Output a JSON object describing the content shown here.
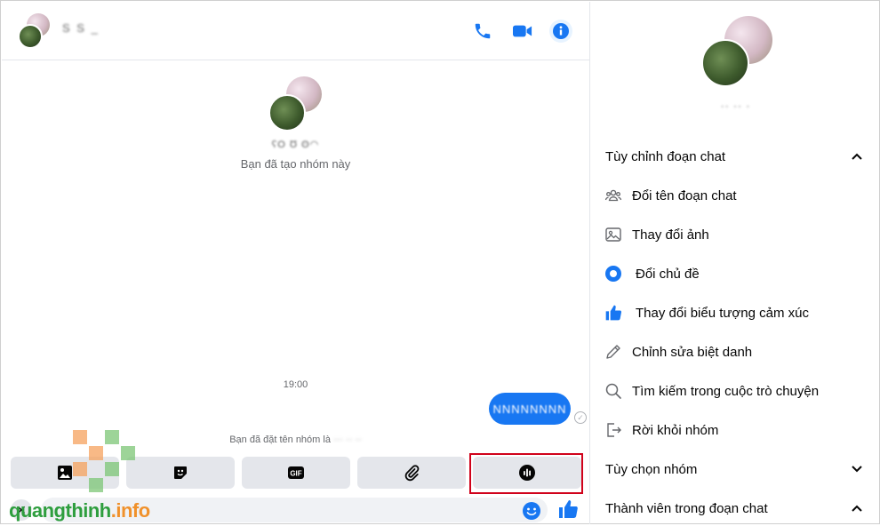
{
  "header": {
    "name": "S  S   _",
    "call_icon": "phone-icon",
    "video_icon": "video-camera-icon",
    "info_icon": "info-icon"
  },
  "conversation": {
    "group_name": "ʕO Ʊ ʘ◠",
    "created_text": "Bạn đã tạo nhóm này",
    "time": "19:00",
    "message": "NNNNNNNN",
    "renamed_prefix": "Bạn đã đặt tên nhóm là",
    "renamed_blur": "··· ·· ··"
  },
  "toolbar": [
    {
      "name": "photo-tool-button",
      "icon": "image-icon"
    },
    {
      "name": "sticker-tool-button",
      "icon": "sticker-icon"
    },
    {
      "name": "gif-tool-button",
      "icon": "gif-icon"
    },
    {
      "name": "attach-tool-button",
      "icon": "paperclip-icon"
    },
    {
      "name": "voice-clip-tool-button",
      "icon": "audio-wave-icon"
    }
  ],
  "watermark": {
    "part1": "quangthinh",
    "part2": ".info"
  },
  "panel": {
    "name": "·· ·· ·",
    "sections": {
      "customize": "Tùy chỉnh đoạn chat",
      "options": "Tùy chọn nhóm",
      "members": "Thành viên trong đoạn chat"
    },
    "items": [
      {
        "label": "Đổi tên đoạn chat",
        "icon": "people-icon"
      },
      {
        "label": "Thay đổi ảnh",
        "icon": "photo-icon"
      },
      {
        "label": "Đổi chủ đề",
        "icon": "theme-dot-icon"
      },
      {
        "label": "Thay đổi biểu tượng cảm xúc",
        "icon": "thumbs-up-icon"
      },
      {
        "label": "Chỉnh sửa biệt danh",
        "icon": "pencil-icon"
      },
      {
        "label": "Tìm kiếm trong cuộc trò chuyện",
        "icon": "search-icon"
      },
      {
        "label": "Rời khỏi nhóm",
        "icon": "leave-icon"
      }
    ]
  },
  "colors": {
    "accent": "#1877f2",
    "highlight": "#d0021b"
  }
}
